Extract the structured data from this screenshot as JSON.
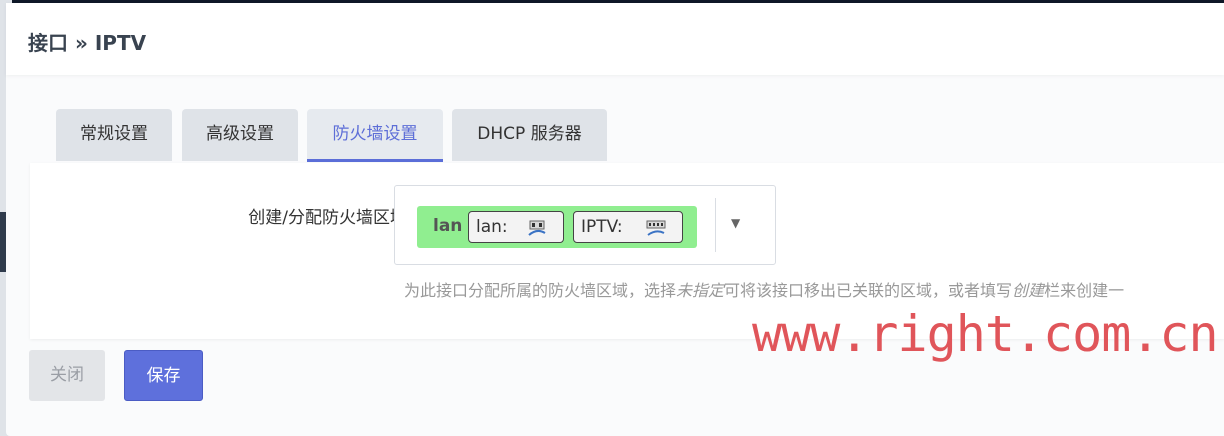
{
  "modal": {
    "title": "接口 » IPTV"
  },
  "tabs": [
    {
      "label": "常规设置",
      "active": false
    },
    {
      "label": "高级设置",
      "active": false
    },
    {
      "label": "防火墙设置",
      "active": true
    },
    {
      "label": "DHCP 服务器",
      "active": false
    }
  ],
  "firewall": {
    "field_label": "创建/分配防火墙区域",
    "zone": {
      "name": "lan",
      "color": "#90ee90",
      "interfaces": [
        {
          "label": "lan:",
          "icon": "ethernet-ports-icon"
        },
        {
          "label": "IPTV:",
          "icon": "ethernet-ports-icon"
        }
      ]
    },
    "help": {
      "part1": "为此接口分配所属的防火墙区域，选择",
      "em1": "未指定",
      "part2": "可将该接口移出已关联的区域，或者填写",
      "em2": "创建",
      "part3": "栏来创建一"
    }
  },
  "buttons": {
    "close": "关闭",
    "save": "保存"
  },
  "watermark": "www.right.com.cn",
  "colors": {
    "accent": "#5e70dc",
    "zone_lan": "#90ee90"
  }
}
